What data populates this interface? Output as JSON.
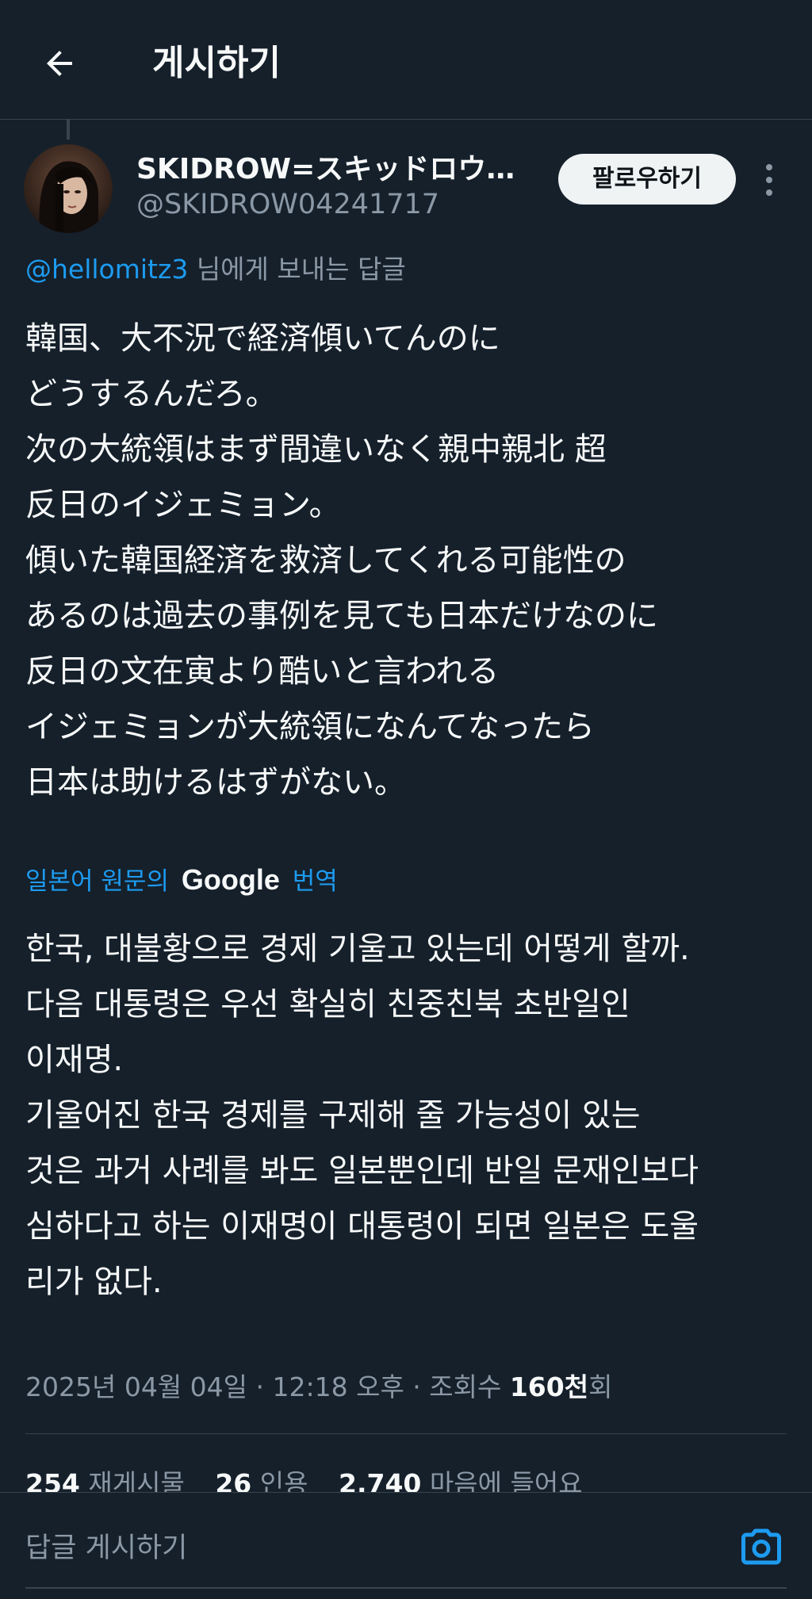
{
  "header": {
    "title": "게시하기"
  },
  "author": {
    "display_name": "SKIDROW=スキッドロウ…",
    "handle": "@SKIDROW04241717",
    "follow_label": "팔로우하기"
  },
  "reply_context": {
    "mention": "@hellomitz3",
    "suffix": " 님에게 보내는 답글"
  },
  "tweet": {
    "lines": [
      "韓国、大不況で経済傾いてんのに",
      "どうするんだろ。",
      "次の大統領はまず間違いなく親中親北 超",
      "反日のイジェミョン。",
      "傾いた韓国経済を救済してくれる可能性の",
      "あるのは過去の事例を見ても日本だけなのに",
      "反日の文在寅より酷いと言われる",
      "イジェミョンが大統領になんてなったら",
      "日本は助けるはずがない。"
    ]
  },
  "translation": {
    "prefix": "일본어 원문의",
    "brand": "Google",
    "suffix": "번역",
    "lines": [
      "한국, 대불황으로 경제 기울고 있는데 어떻게 할까.",
      "다음 대통령은 우선 확실히 친중친북 초반일인",
      "이재명.",
      "기울어진 한국 경제를 구제해 줄 가능성이 있는",
      "것은 과거 사례를 봐도 일본뿐인데 반일 문재인보다",
      "심하다고 하는 이재명이 대통령이 되면 일본은 도울",
      "리가 없다."
    ]
  },
  "meta": {
    "timestamp": "2025년 04월 04일 · 12:18 오후 · 조회수 ",
    "views": "160천",
    "views_suffix": "회"
  },
  "stats": {
    "reposts_count": "254",
    "reposts_label": "재게시물",
    "quotes_count": "26",
    "quotes_label": "인용",
    "likes_count": "2,740",
    "likes_label": "마음에 들어요"
  },
  "reply_bar": {
    "placeholder": "답글 게시하기"
  },
  "colors": {
    "background": "#15202b",
    "accent": "#1d9bf0",
    "secondary_text": "#8b98a5"
  }
}
